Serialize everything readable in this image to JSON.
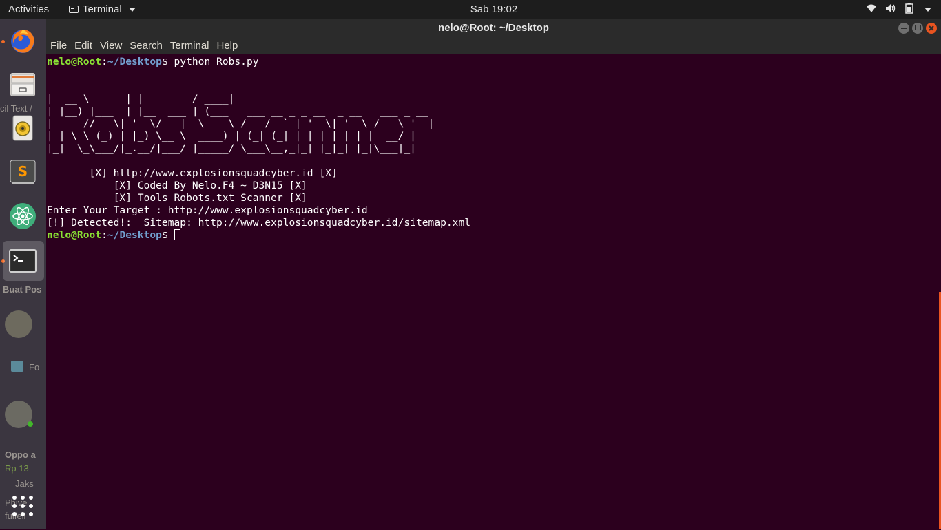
{
  "topbar": {
    "activities": "Activities",
    "app_name": "Terminal",
    "clock": "Sab 19:02",
    "tray_icons": [
      "wifi-icon",
      "volume-icon",
      "battery-icon"
    ]
  },
  "dock": {
    "items": [
      "firefox-icon",
      "files-icon",
      "rhythmbox-icon",
      "sublime-text-icon",
      "atom-icon",
      "terminal-icon",
      "show-apps-icon"
    ],
    "background_text": [
      "cil Text /",
      "Buat Pos",
      "Fo",
      "Oppo a",
      "Rp 13",
      "Jaks",
      "Phive",
      "fulfeli"
    ]
  },
  "window": {
    "title": "nelo@Root: ~/Desktop",
    "menu": [
      "File",
      "Edit",
      "View",
      "Search",
      "Terminal",
      "Help"
    ]
  },
  "terminal": {
    "prompt_user": "nelo@Root",
    "prompt_path": "~/Desktop",
    "command": "python Robs.py",
    "banner": [
      "",
      " _____        _          _____",
      "|  __ \\      | |        / ____|",
      "| |__) |___  | |__  ___ | (___   ___ __ _ _ __  _ __   ___ _ __",
      "|  _  // _ \\| '_ \\/ __|  \\___ \\ / __/ _` | '_ \\| '_ \\ / _ \\ '__|",
      "| | \\ \\ (_) | |_) \\__ \\  ____) | (_| (_| | | | | | | |  __/ |",
      "|_|  \\_\\___/|_.__/|___/ |_____/ \\___\\__,_|_| |_|_| |_|\\___|_|",
      ""
    ],
    "info_lines": [
      "       [X] http://www.explosionsquadcyber.id [X]",
      "           [X] Coded By Nelo.F4 ~ D3N15 [X]",
      "           [X] Tools Robots.txt Scanner [X]",
      "Enter Your Target : http://www.explosionsquadcyber.id",
      "[!] Detected!:  Sitemap: http://www.explosionsquadcyber.id/sitemap.xml"
    ]
  },
  "colors": {
    "terminal_bg": "#2c001e",
    "prompt_user": "#8ae234",
    "prompt_path": "#729fcf",
    "accent": "#e95420",
    "close_button": "#e95420"
  }
}
